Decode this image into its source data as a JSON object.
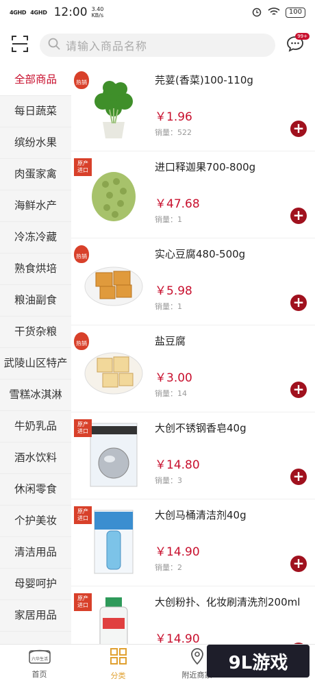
{
  "status_bar": {
    "signal1": "4GHD",
    "signal2": "4GHD",
    "time": "12:00",
    "speed_value": "3.40",
    "speed_unit": "KB/s",
    "battery": "100"
  },
  "search": {
    "placeholder": "请输入商品名称"
  },
  "message_badge": "99+",
  "categories": [
    "全部商品",
    "每日蔬菜",
    "缤纷水果",
    "肉蛋家禽",
    "海鲜水产",
    "冷冻冷藏",
    "熟食烘培",
    "粮油副食",
    "干货杂粮",
    "武陵山区特产",
    "雪糕冰淇淋",
    "牛奶乳品",
    "酒水饮料",
    "休闲零食",
    "个护美妆",
    "清洁用品",
    "母婴呵护",
    "家居用品"
  ],
  "products": [
    {
      "name": "芫荽(香菜)100-110g",
      "price": "￥1.96",
      "sales": "销量：522",
      "tag": "热销",
      "tag_type": "hot"
    },
    {
      "name": "进口释迦果700-800g",
      "price": "￥47.68",
      "sales": "销量：1",
      "tag": "原产进口",
      "tag_type": "import"
    },
    {
      "name": "实心豆腐480-500g",
      "price": "￥5.98",
      "sales": "销量：1",
      "tag": "热销",
      "tag_type": "hot"
    },
    {
      "name": "盐豆腐",
      "price": "￥3.00",
      "sales": "销量：14",
      "tag": "热销",
      "tag_type": "hot"
    },
    {
      "name": "大创不锈钢香皂40g",
      "price": "￥14.80",
      "sales": "销量：3",
      "tag": "原产进口",
      "tag_type": "import"
    },
    {
      "name": "大创马桶清洁剂40g",
      "price": "￥14.90",
      "sales": "销量：2",
      "tag": "原产进口",
      "tag_type": "import"
    },
    {
      "name": "大创粉扑、化妆刷清洗剂200ml",
      "price": "￥14.90",
      "sales": "",
      "tag": "原产进口",
      "tag_type": "import"
    }
  ],
  "tabs": [
    {
      "label": "首页",
      "icon": "home-icon"
    },
    {
      "label": "分类",
      "icon": "category-icon"
    },
    {
      "label": "附近商家",
      "icon": "location-icon"
    }
  ],
  "thumb_tag_small": "六华生活",
  "watermark": "9L游戏",
  "colors": {
    "accent": "#c8102e",
    "tab_active": "#e0a030"
  }
}
